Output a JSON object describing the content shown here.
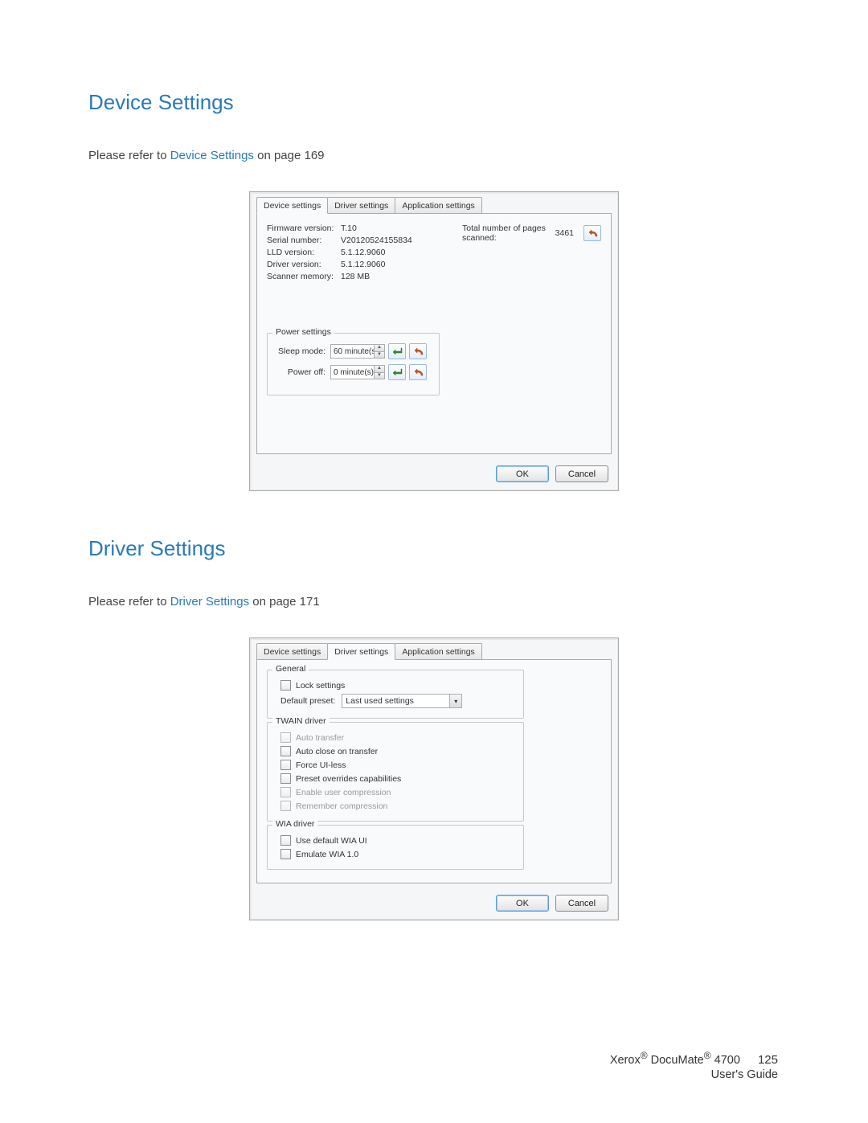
{
  "section1": {
    "heading": "Device Settings",
    "refer_pre": "Please refer to ",
    "refer_link": "Device Settings",
    "refer_post": " on page 169"
  },
  "dialog1": {
    "tabs": {
      "device": "Device settings",
      "driver": "Driver settings",
      "app": "Application settings"
    },
    "info": {
      "firmware_label": "Firmware version:",
      "firmware_value": "T.10",
      "serial_label": "Serial number:",
      "serial_value": "V20120524155834",
      "lld_label": "LLD version:",
      "lld_value": "5.1.12.9060",
      "driverv_label": "Driver version:",
      "driverv_value": "5.1.12.9060",
      "mem_label": "Scanner memory:",
      "mem_value": "128 MB"
    },
    "stats": {
      "pages_label": "Total number of pages scanned:",
      "pages_value": "3461"
    },
    "power": {
      "legend": "Power settings",
      "sleep_label": "Sleep mode:",
      "sleep_value": "60 minute(s)",
      "off_label": "Power off:",
      "off_value": "0 minute(s)"
    },
    "buttons": {
      "ok": "OK",
      "cancel": "Cancel"
    }
  },
  "section2": {
    "heading": "Driver Settings",
    "refer_pre": "Please refer to ",
    "refer_link": "Driver Settings",
    "refer_post": " on page 171"
  },
  "dialog2": {
    "tabs": {
      "device": "Device settings",
      "driver": "Driver settings",
      "app": "Application settings"
    },
    "general": {
      "legend": "General",
      "lock": "Lock settings",
      "preset_label": "Default preset:",
      "preset_value": "Last used settings"
    },
    "twain": {
      "legend": "TWAIN driver",
      "auto_transfer": "Auto transfer",
      "auto_close": "Auto close on transfer",
      "force_ui": "Force UI-less",
      "preset_override": "Preset overrides capabilities",
      "enable_comp": "Enable user compression",
      "remember_comp": "Remember compression"
    },
    "wia": {
      "legend": "WIA driver",
      "use_default": "Use default WIA UI",
      "emulate": "Emulate WIA 1.0"
    },
    "buttons": {
      "ok": "OK",
      "cancel": "Cancel"
    }
  },
  "footer": {
    "line1a": "Xerox",
    "line1b": " DocuMate",
    "line1c": " 4700",
    "page": "125",
    "line2": "User's Guide"
  }
}
